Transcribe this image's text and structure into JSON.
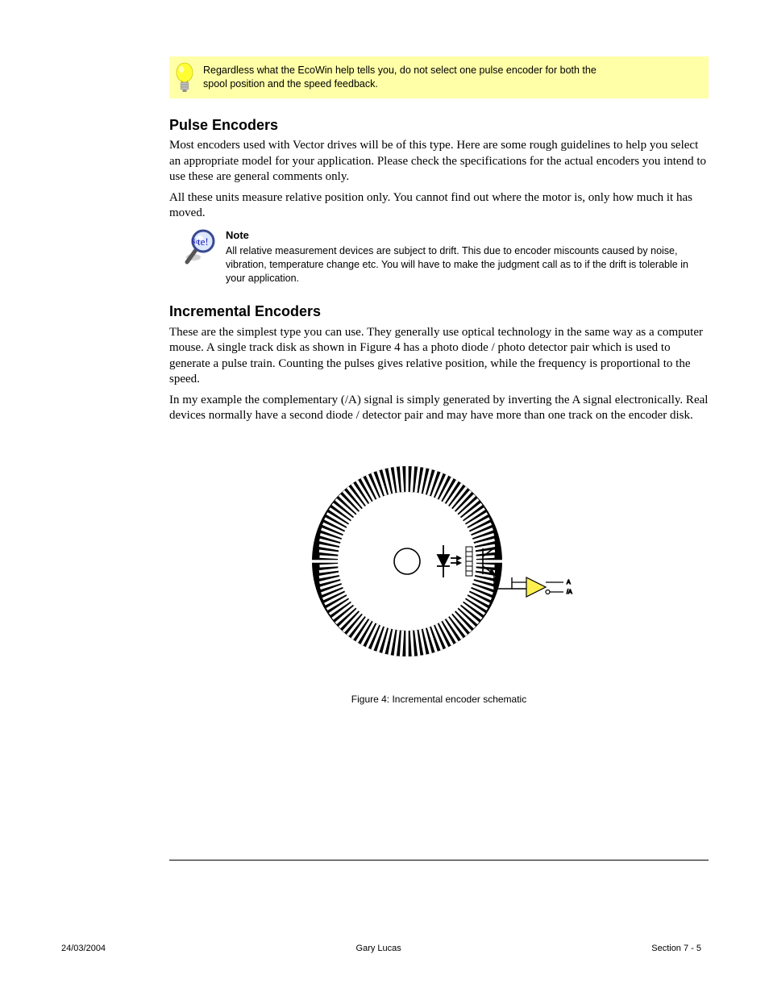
{
  "tip": {
    "line1": "Regardless what the EcoWin help tells you, do not select one pulse encoder for both the",
    "line2": "spool position and the speed feedback."
  },
  "sections": {
    "pulse_encoders": {
      "title": "Pulse Encoders",
      "body1": "Most encoders used with Vector drives will be of this type. Here are some rough guidelines to help you select an appropriate model for your application. Please check the specifications for the actual encoders you intend to use these are general comments only.",
      "body2": "All these units measure relative position only. You cannot find out where the motor is, only how much it has moved.",
      "note_label": "Note",
      "note_text": "All relative measurement devices are subject to drift. This due to encoder miscounts caused by noise, vibration, temperature change etc. You will have to make the judgment call as to if the drift is tolerable in your application."
    },
    "incremental": {
      "title": "Incremental Encoders",
      "body1_pre": "These are the simplest type you can use. They generally use optical technology in the same way as a computer mouse. A single track disk as shown in ",
      "figure_ref": "Figure 4",
      "body1_post": " has a photo diode / photo detector pair which is used to generate a pulse train. Counting the pulses gives relative position, while the frequency is proportional to the speed.",
      "body2": "In my example the complementary (/A) signal is simply generated by inverting the A signal electronically. Real devices normally have a second diode / detector pair and may have more than one track on the encoder disk.",
      "figure_caption": "Figure 4: Incremental encoder schematic"
    }
  },
  "footer": {
    "left": "24/03/2004",
    "center": "Gary Lucas",
    "right": "Section 7 - 5"
  },
  "svg_labels": {
    "a": "A",
    "not_a": "/A"
  }
}
